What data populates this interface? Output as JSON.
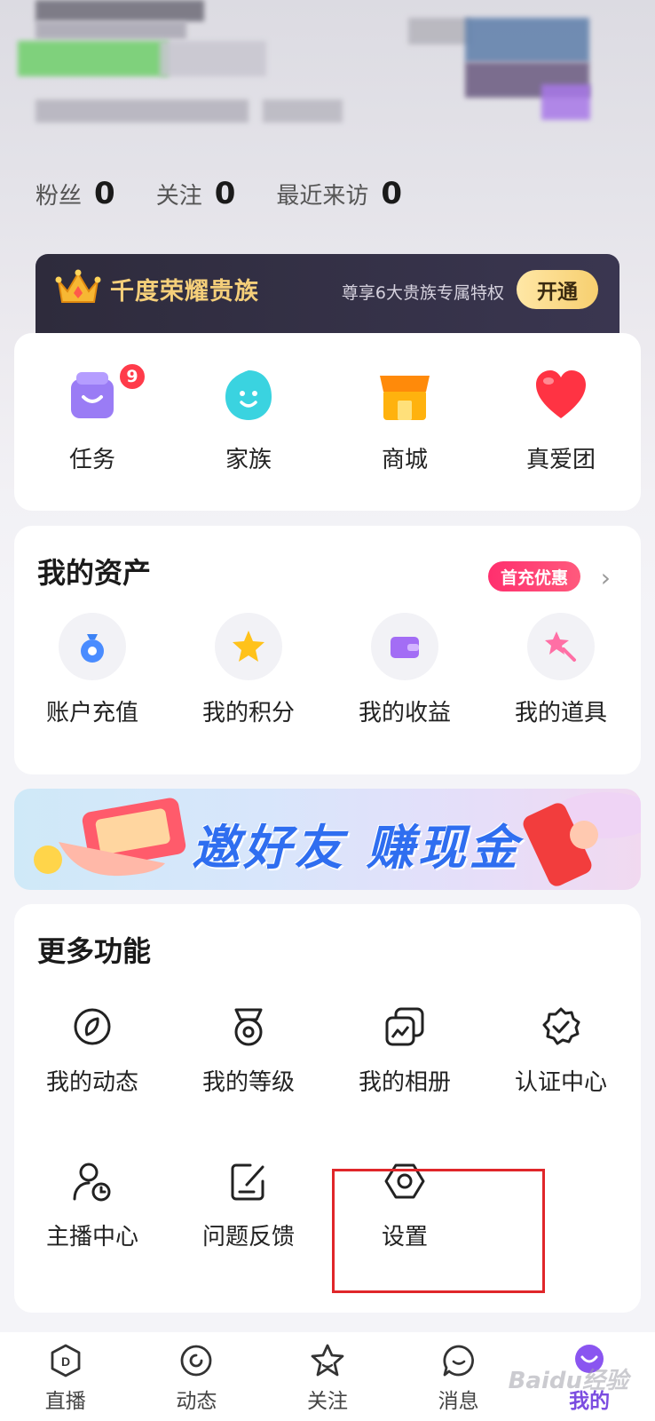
{
  "profile": {
    "stats": [
      {
        "label": "粉丝",
        "value": "0"
      },
      {
        "label": "关注",
        "value": "0"
      },
      {
        "label": "最近来访",
        "value": "0"
      }
    ]
  },
  "noble_banner": {
    "title": "千度荣耀贵族",
    "description": "尊享6大贵族专属特权",
    "button": "开通"
  },
  "quick_actions": [
    {
      "label": "任务",
      "icon": "task-bag-icon",
      "badge": "9"
    },
    {
      "label": "家族",
      "icon": "family-icon"
    },
    {
      "label": "商城",
      "icon": "shop-icon"
    },
    {
      "label": "真爱团",
      "icon": "heart-icon"
    }
  ],
  "assets": {
    "title": "我的资产",
    "promo_badge": "首充优惠",
    "items": [
      {
        "label": "账户充值",
        "icon": "money-bag-icon"
      },
      {
        "label": "我的积分",
        "icon": "star-icon"
      },
      {
        "label": "我的收益",
        "icon": "wallet-icon"
      },
      {
        "label": "我的道具",
        "icon": "wand-icon"
      }
    ]
  },
  "invite_banner": {
    "text": "邀好友 赚现金"
  },
  "more": {
    "title": "更多功能",
    "items": [
      {
        "label": "我的动态",
        "icon": "moments-icon"
      },
      {
        "label": "我的等级",
        "icon": "medal-icon"
      },
      {
        "label": "我的相册",
        "icon": "album-icon"
      },
      {
        "label": "认证中心",
        "icon": "verified-icon"
      },
      {
        "label": "主播中心",
        "icon": "streamer-icon"
      },
      {
        "label": "问题反馈",
        "icon": "feedback-icon"
      },
      {
        "label": "设置",
        "icon": "settings-icon"
      }
    ]
  },
  "tabbar": [
    {
      "label": "直播",
      "icon": "live-icon"
    },
    {
      "label": "动态",
      "icon": "feed-icon"
    },
    {
      "label": "关注",
      "icon": "star-outline-icon"
    },
    {
      "label": "消息",
      "icon": "message-icon"
    },
    {
      "label": "我的",
      "icon": "profile-icon",
      "active": true
    }
  ],
  "watermark": "Baidu经验",
  "colors": {
    "accent": "#7b4ce0",
    "highlight": "#e0262a",
    "gold": "#f5cf7a",
    "promo": "#ff2f6e"
  }
}
